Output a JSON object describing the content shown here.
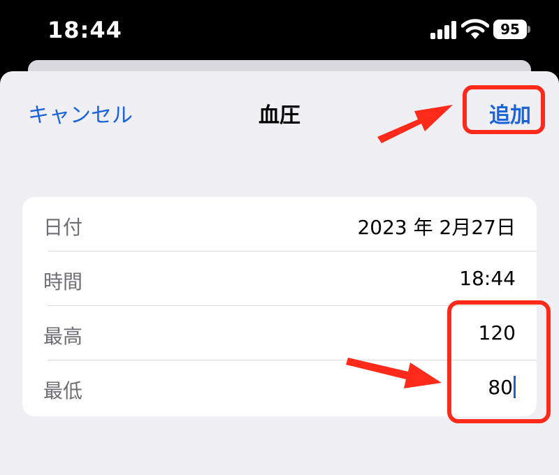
{
  "status_bar": {
    "time": "18:44",
    "battery": "95"
  },
  "nav": {
    "cancel": "キャンセル",
    "title": "血圧",
    "add": "追加"
  },
  "rows": [
    {
      "label": "日付",
      "value": "2023 年 2月27日"
    },
    {
      "label": "時間",
      "value": "18:44"
    },
    {
      "label": "最高",
      "value": "120"
    },
    {
      "label": "最低",
      "value": "80"
    }
  ],
  "colors": {
    "accent": "#1a63d8",
    "highlight": "#ff2a1a",
    "sheet": "#efeff4"
  },
  "icons": [
    "signal-icon",
    "wifi-icon",
    "battery-icon",
    "arrow-annotation-icon"
  ]
}
